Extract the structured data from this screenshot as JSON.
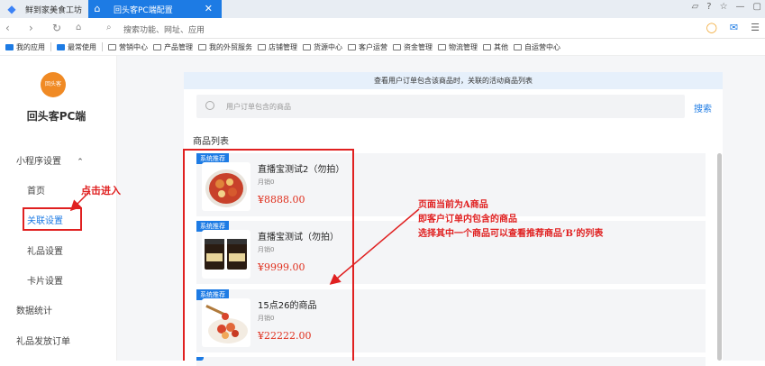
{
  "browser": {
    "tabs": [
      {
        "label": "鲜到家美食工坊"
      },
      {
        "label": "回头客PC端配置"
      }
    ],
    "address_placeholder": "搜索功能、网址、应用",
    "bookmarks": [
      "我的应用",
      "最常使用",
      "营销中心",
      "产品管理",
      "我的外贸服务",
      "店铺管理",
      "货源中心",
      "客户运营",
      "资金管理",
      "物流管理",
      "其他",
      "自运营中心"
    ]
  },
  "sidebar": {
    "logo_text": "回头客",
    "title": "回头客PC端",
    "group": "小程序设置",
    "group_chevron": "⌃",
    "sub_items": [
      "首页",
      "关联设置",
      "礼品设置",
      "卡片设置"
    ],
    "items": [
      "数据统计",
      "礼品发放订单"
    ]
  },
  "main": {
    "notice": "查看用户订单包含该商品时，关联的活动商品列表",
    "search_placeholder": "用户订单包含的商品",
    "search_button": "搜索",
    "list_title": "商品列表",
    "products": [
      {
        "badge": "系统推荐",
        "name": "直播宝测试2（勿拍）",
        "sales": "月销0",
        "price": "¥8888.00"
      },
      {
        "badge": "系统推荐",
        "name": "直播宝测试（勿拍）",
        "sales": "月销0",
        "price": "¥9999.00"
      },
      {
        "badge": "系统推荐",
        "name": "15点26的商品",
        "sales": "月销0",
        "price": "¥22222.00"
      }
    ]
  },
  "annotations": {
    "click_enter": "点击进入",
    "line1": "页面当前为A商品",
    "line2": "即客户订单内包含的商品",
    "line3": "选择其中一个商品可以查看推荐商品‘B’的列表"
  },
  "colors": {
    "accent": "#1d7be4",
    "annotation": "#e02020",
    "price": "#e0301e"
  }
}
